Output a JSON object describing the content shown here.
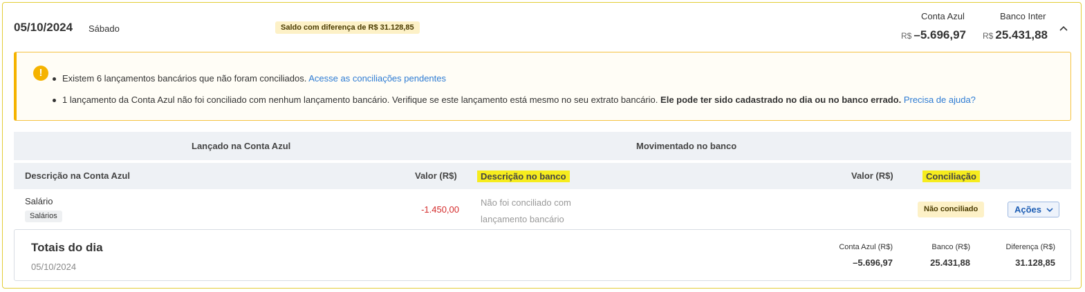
{
  "header": {
    "date": "05/10/2024",
    "weekday": "Sábado",
    "difference_badge": "Saldo com diferença de R$ 31.128,85",
    "balances": [
      {
        "label": "Conta Azul",
        "currency": "R$",
        "value": "–5.696,97"
      },
      {
        "label": "Banco Inter",
        "currency": "R$",
        "value": "25.431,88"
      }
    ],
    "collapse_icon": "chevron-up-icon"
  },
  "alert": {
    "icon": "exclamation-icon",
    "item1_text": "Existem 6 lançamentos bancários que não foram conciliados.",
    "item1_link": "Acesse as conciliações pendentes",
    "item2_text": "1 lançamento da Conta Azul não foi conciliado com nenhum lançamento bancário. Verifique se este lançamento está mesmo no seu extrato bancário.",
    "item2_bold": "Ele pode ter sido cadastrado no dia ou no banco errado.",
    "item2_link": "Precisa de ajuda?"
  },
  "table": {
    "group_left": "Lançado na Conta Azul",
    "group_right": "Movimentado no banco",
    "columns": {
      "desc_conta_azul": "Descrição na Conta Azul",
      "valor_left": "Valor (R$)",
      "desc_banco": "Descrição no banco",
      "valor_right": "Valor (R$)",
      "conciliacao": "Conciliação"
    },
    "rows": [
      {
        "description": "Salário",
        "tag": "Salários",
        "value": "-1.450,00",
        "bank_description": "Não foi conciliado com lançamento bancário",
        "status": "Não conciliado",
        "actions_label": "Ações"
      }
    ]
  },
  "totals": {
    "title": "Totais do dia",
    "date": "05/10/2024",
    "columns": [
      {
        "label": "Conta Azul (R$)",
        "value": "–5.696,97"
      },
      {
        "label": "Banco (R$)",
        "value": "25.431,88"
      },
      {
        "label": "Diferença (R$)",
        "value": "31.128,85"
      }
    ]
  },
  "colors": {
    "accent_border": "#e3cc35",
    "warning": "#f5b300",
    "highlight": "#f6ec1e",
    "link": "#2d7bd3",
    "negative": "#d42b2b"
  }
}
